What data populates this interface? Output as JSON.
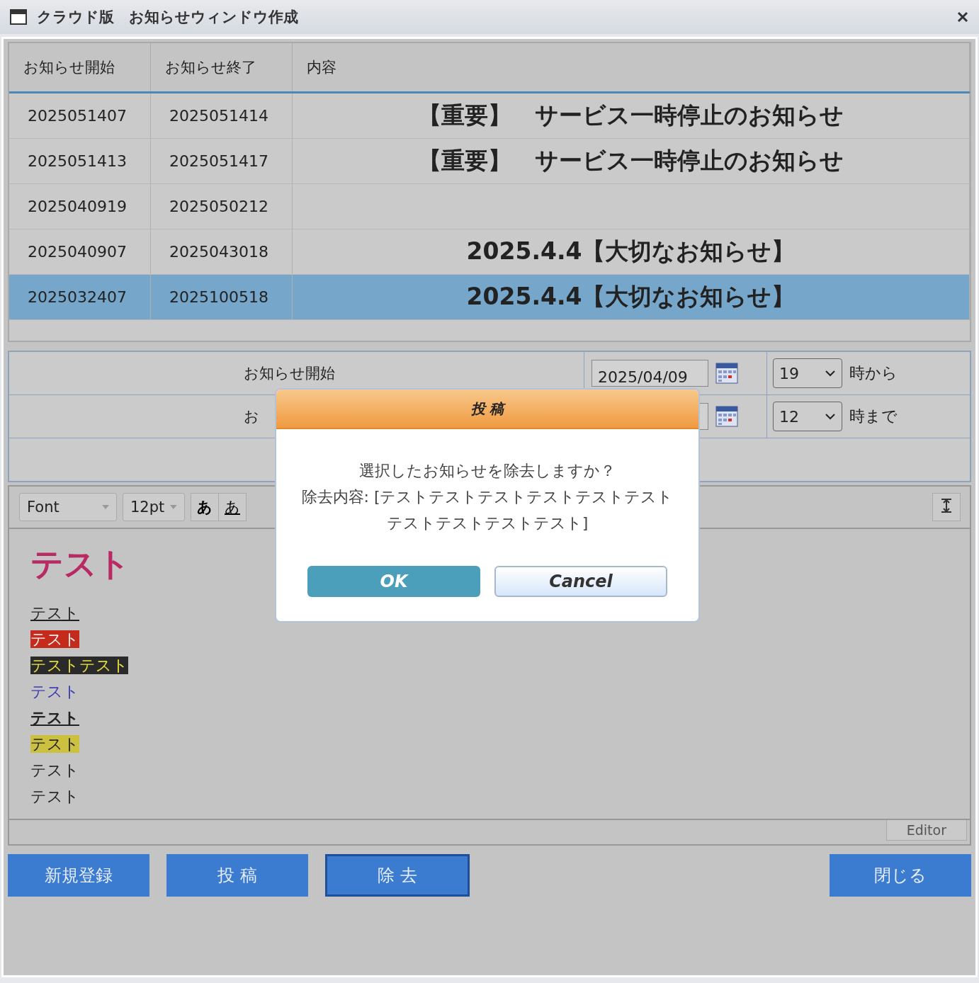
{
  "window": {
    "title": "クラウド版　お知らせウィンドウ作成"
  },
  "table": {
    "columns": [
      "お知らせ開始",
      "お知らせ終了",
      "内容"
    ],
    "rows": [
      {
        "start": "2025051407",
        "end": "2025051414",
        "content": "【重要】　サービス一時停止のお知らせ",
        "selected": false
      },
      {
        "start": "2025051413",
        "end": "2025051417",
        "content": "【重要】　サービス一時停止のお知らせ",
        "selected": false
      },
      {
        "start": "2025040919",
        "end": "2025050212",
        "content": "",
        "selected": false
      },
      {
        "start": "2025040907",
        "end": "2025043018",
        "content": "2025.4.4【大切なお知らせ】",
        "selected": false
      },
      {
        "start": "2025032407",
        "end": "2025100518",
        "content": "2025.4.4【大切なお知らせ】",
        "selected": true
      }
    ]
  },
  "form": {
    "rows": [
      {
        "label": "お知らせ開始",
        "date": "2025/04/09",
        "hour": "19",
        "suffix": "時から"
      },
      {
        "label": "お",
        "date": "",
        "hour": "12",
        "suffix": "時まで"
      }
    ]
  },
  "editor": {
    "font": "Font",
    "size": "12pt",
    "style_buttons": [
      "あ",
      "あ"
    ],
    "tab": "Editor",
    "lines": [
      {
        "kind": "heading",
        "text": "テスト"
      },
      {
        "kind": "underline",
        "text": "テスト"
      },
      {
        "kind": "red",
        "text": "テスト"
      },
      {
        "kind": "dark",
        "text": "テストテスト"
      },
      {
        "kind": "blue",
        "text": "テスト"
      },
      {
        "kind": "bold-underline",
        "text": "テスト"
      },
      {
        "kind": "yellow",
        "text": "テスト"
      },
      {
        "kind": "plain",
        "text": "テスト"
      },
      {
        "kind": "plain",
        "text": "テスト"
      }
    ]
  },
  "buttons": [
    {
      "label": "新規登録",
      "focused": false
    },
    {
      "label": "投 稿",
      "focused": false
    },
    {
      "label": "除 去",
      "focused": true
    }
  ],
  "close_button": "閉じる",
  "dialog": {
    "title": "投 稿",
    "message": "選択したお知らせを除去しますか？",
    "detail": "除去内容: [テストテストテストテストテストテストテストテストテストテスト]",
    "ok": "OK",
    "cancel": "Cancel"
  }
}
